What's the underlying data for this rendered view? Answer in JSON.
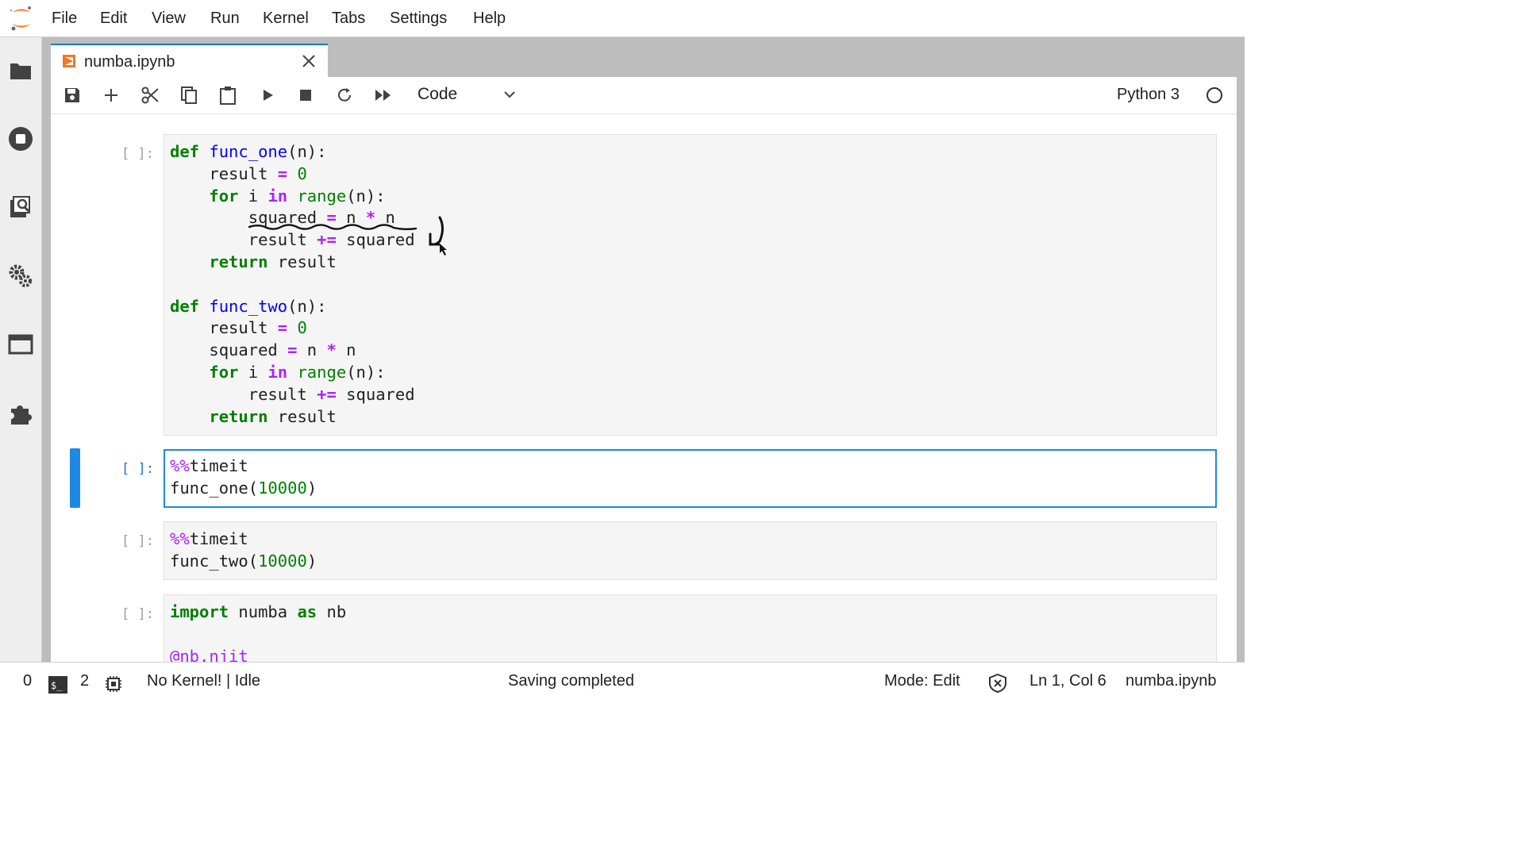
{
  "menu": [
    "File",
    "Edit",
    "View",
    "Run",
    "Kernel",
    "Tabs",
    "Settings",
    "Help"
  ],
  "sidebar_icons": [
    "folder-icon",
    "running-kernels-icon",
    "command-palette-icon",
    "property-inspector-icon",
    "tabs-icon",
    "extension-icon"
  ],
  "tab": {
    "label": "numba.ipynb"
  },
  "toolbar": {
    "icons": [
      "save-icon",
      "add-cell-icon",
      "cut-icon",
      "copy-icon",
      "paste-icon",
      "run-icon",
      "stop-icon",
      "restart-icon",
      "run-all-icon"
    ],
    "cell_type": "Code",
    "kernel": "Python 3"
  },
  "cells": [
    {
      "prompt": "[ ]:",
      "active": false
    },
    {
      "prompt": "[ ]:",
      "active": true
    },
    {
      "prompt": "[ ]:",
      "active": false
    },
    {
      "prompt": "[ ]:",
      "active": false
    }
  ],
  "status": {
    "terminals": "0",
    "kernels": "2",
    "kernel_state": "No Kernel! | Idle",
    "message": "Saving completed",
    "mode": "Mode: Edit",
    "position": "Ln 1, Col 6",
    "file": "numba.ipynb"
  },
  "colors": {
    "accent": "#1e88e5",
    "keyword": "#008000",
    "operator": "#aa22ff",
    "function_name": "#0000ff",
    "logo": "#f37726"
  }
}
